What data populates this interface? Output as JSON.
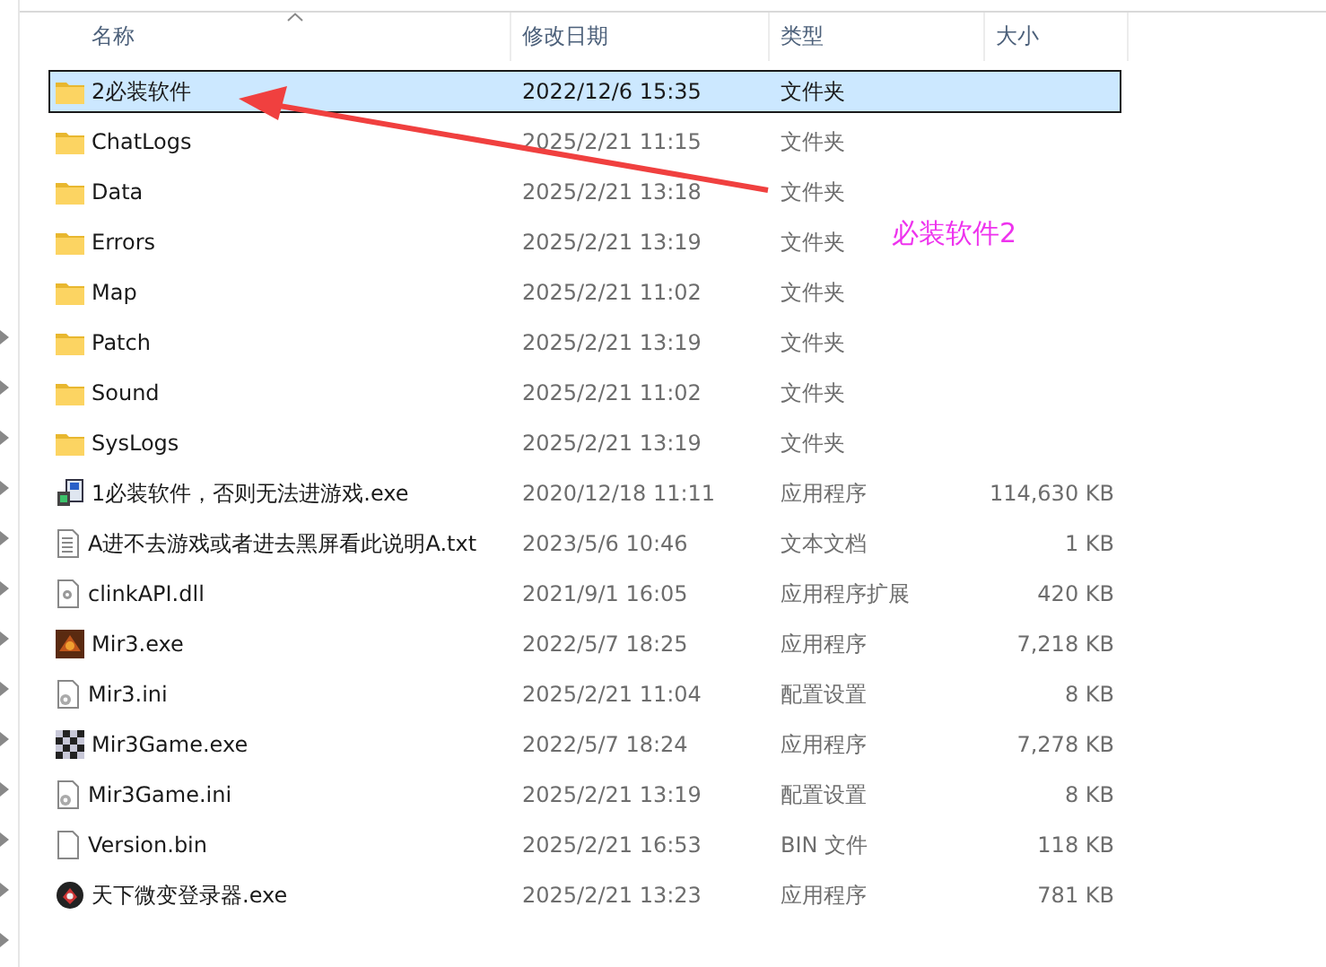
{
  "columns": [
    {
      "label": "名称",
      "sorted": true
    },
    {
      "label": "修改日期",
      "sorted": false
    },
    {
      "label": "类型",
      "sorted": false
    },
    {
      "label": "大小",
      "sorted": false
    }
  ],
  "rows": [
    {
      "kind": "folder",
      "name": "2必装软件",
      "date": "2022/12/6 15:35",
      "type": "文件夹",
      "selected": true
    },
    {
      "kind": "folder",
      "name": "ChatLogs",
      "date": "2025/2/21 11:15",
      "type": "文件夹",
      "selected": false
    },
    {
      "kind": "folder",
      "name": "Data",
      "date": "2025/2/21 13:18",
      "type": "文件夹",
      "selected": false
    },
    {
      "kind": "folder",
      "name": "Errors",
      "date": "2025/2/21 13:19",
      "type": "文件夹",
      "selected": false
    },
    {
      "kind": "folder",
      "name": "Map",
      "date": "2025/2/21 11:02",
      "type": "文件夹",
      "selected": false
    },
    {
      "kind": "folder",
      "name": "Patch",
      "date": "2025/2/21 13:19",
      "type": "文件夹",
      "selected": false
    },
    {
      "kind": "folder",
      "name": "Sound",
      "date": "2025/2/21 11:02",
      "type": "文件夹",
      "selected": false
    },
    {
      "kind": "folder",
      "name": "SysLogs",
      "date": "2025/2/21 13:19",
      "type": "文件夹",
      "selected": false
    },
    {
      "kind": "installer",
      "name": "1必装软件，否则无法进游戏.exe",
      "date": "2020/12/18 11:11",
      "type": "应用程序",
      "size": "114,630 KB",
      "selected": false
    },
    {
      "kind": "text",
      "name": "A进不去游戏或者进去黑屏看此说明A.txt",
      "date": "2023/5/6 10:46",
      "type": "文本文档",
      "size": "1 KB",
      "selected": false
    },
    {
      "kind": "library",
      "name": "clinkAPI.dll",
      "date": "2021/9/1 16:05",
      "type": "应用程序扩展",
      "size": "420 KB",
      "selected": false
    },
    {
      "kind": "game",
      "name": "Mir3.exe",
      "date": "2022/5/7 18:25",
      "type": "应用程序",
      "size": "7,218 KB",
      "selected": false
    },
    {
      "kind": "config",
      "name": "Mir3.ini",
      "date": "2025/2/21 11:04",
      "type": "配置设置",
      "size": "8 KB",
      "selected": false
    },
    {
      "kind": "mosaic",
      "name": "Mir3Game.exe",
      "date": "2022/5/7 18:24",
      "type": "应用程序",
      "size": "7,278 KB",
      "selected": false
    },
    {
      "kind": "config",
      "name": "Mir3Game.ini",
      "date": "2025/2/21 13:19",
      "type": "配置设置",
      "size": "8 KB",
      "selected": false
    },
    {
      "kind": "file",
      "name": "Version.bin",
      "date": "2025/2/21 16:53",
      "type": "BIN 文件",
      "size": "118 KB",
      "selected": false
    },
    {
      "kind": "round",
      "name": "天下微变登录器.exe",
      "date": "2025/2/21 13:23",
      "type": "应用程序",
      "size": "781 KB",
      "selected": false
    }
  ],
  "annotation": {
    "text": "必装软件2"
  }
}
